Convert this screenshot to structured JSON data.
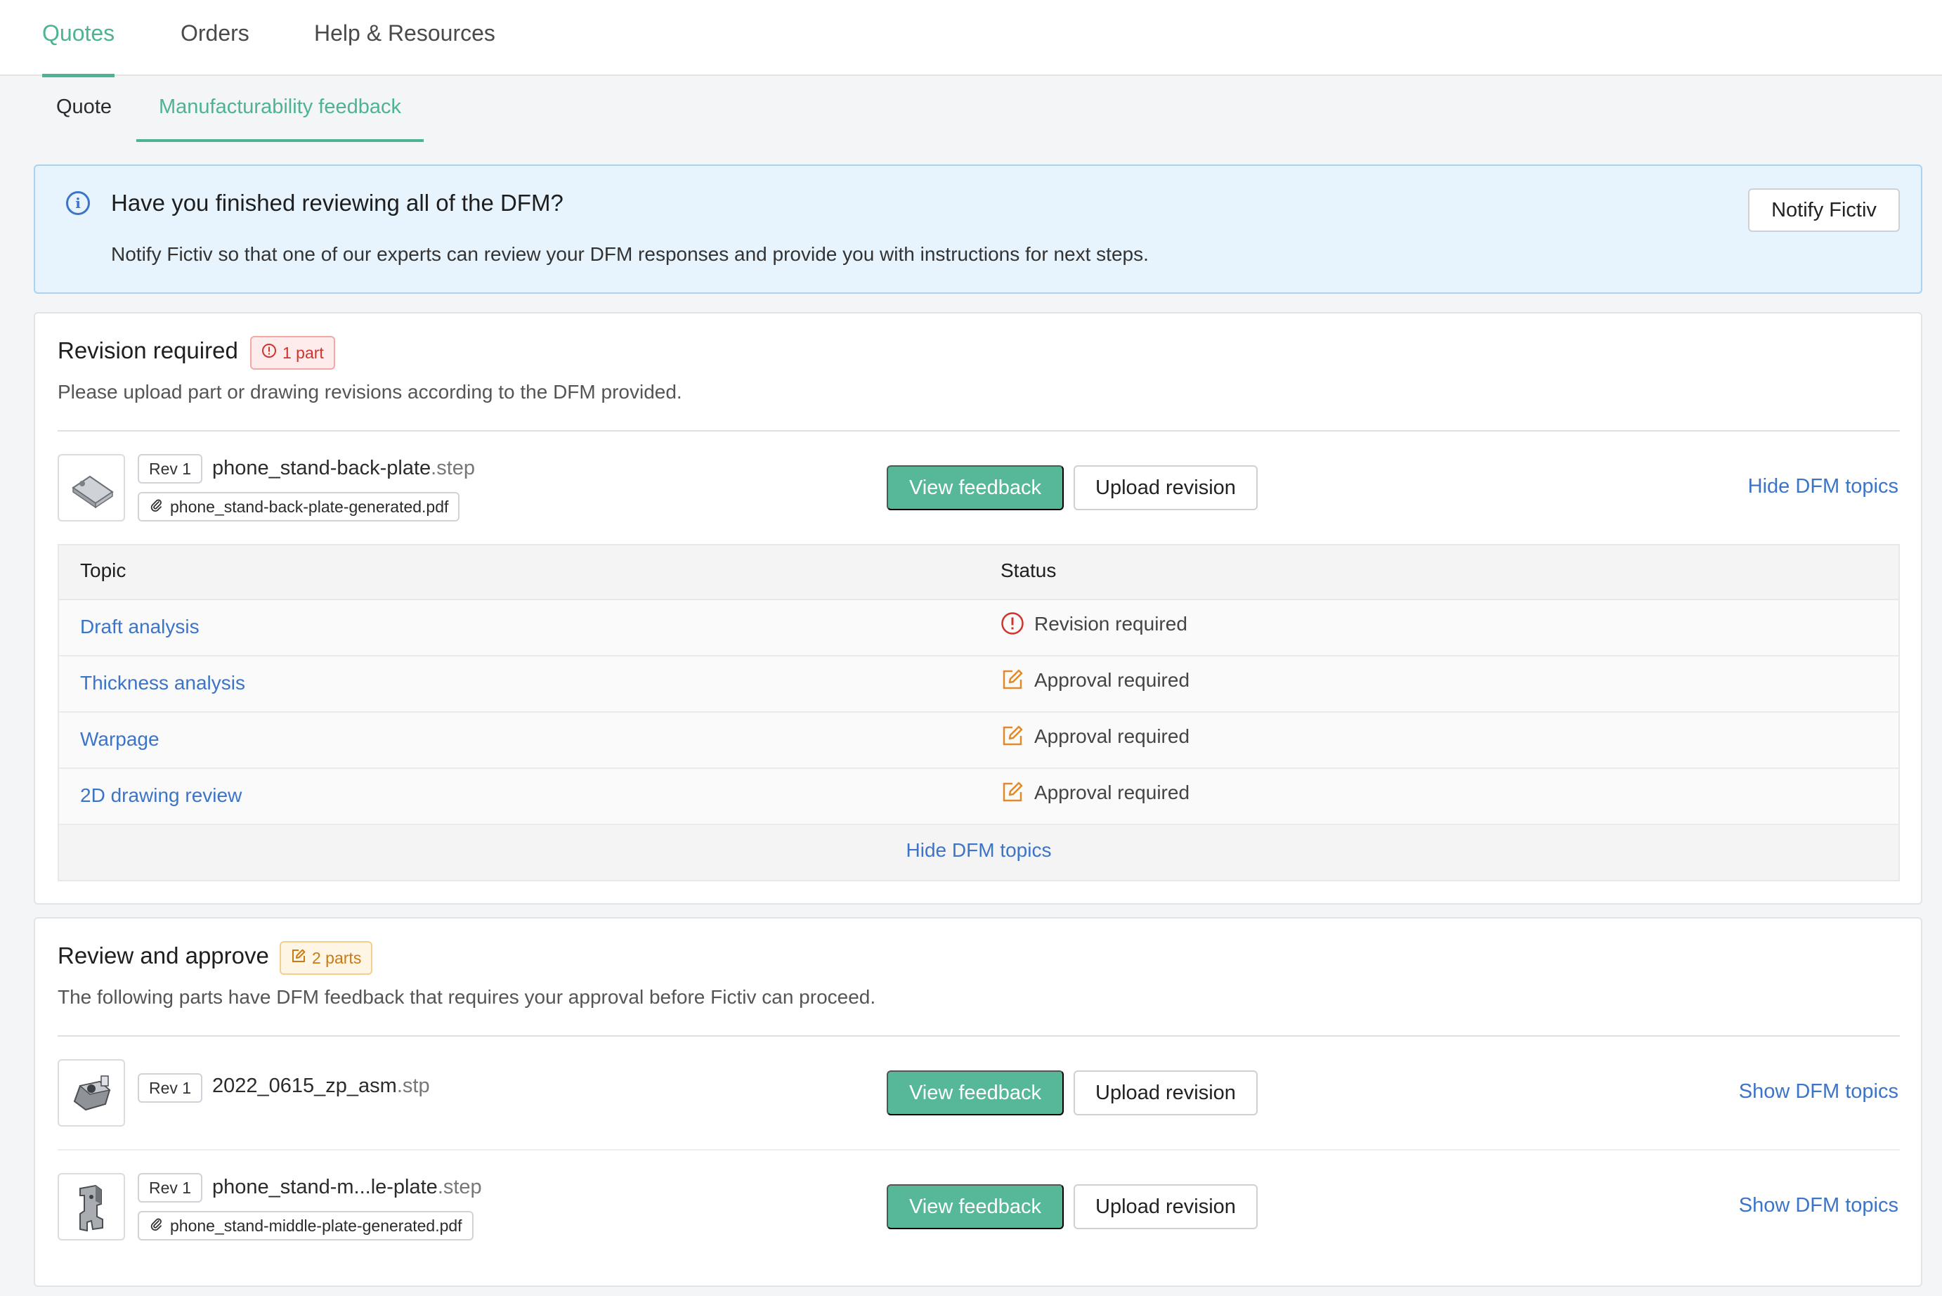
{
  "nav": {
    "tabs": [
      {
        "label": "Quotes",
        "active": true
      },
      {
        "label": "Orders",
        "active": false
      },
      {
        "label": "Help & Resources",
        "active": false
      }
    ]
  },
  "subnav": {
    "tabs": [
      {
        "label": "Quote",
        "active": false
      },
      {
        "label": "Manufacturability feedback",
        "active": true
      }
    ]
  },
  "banner": {
    "title": "Have you finished reviewing all of the DFM?",
    "description": "Notify Fictiv so that one of our experts can review your DFM responses and provide you with instructions for next steps.",
    "button": "Notify Fictiv",
    "icon": "info-icon"
  },
  "revision_section": {
    "heading": "Revision required",
    "badge": "1 part",
    "description": "Please upload part or drawing revisions according to the DFM provided.",
    "part": {
      "rev": "Rev 1",
      "name": "phone_stand-back-plate",
      "ext": ".step",
      "attachment": "phone_stand-back-plate-generated.pdf",
      "view_button": "View feedback",
      "upload_button": "Upload revision",
      "toggle_link": "Hide DFM topics"
    },
    "table": {
      "col_topic": "Topic",
      "col_status": "Status",
      "rows": [
        {
          "topic": "Draft analysis",
          "status": "Revision required",
          "status_type": "revision"
        },
        {
          "topic": "Thickness analysis",
          "status": "Approval required",
          "status_type": "approval"
        },
        {
          "topic": "Warpage",
          "status": "Approval required",
          "status_type": "approval"
        },
        {
          "topic": "2D drawing review",
          "status": "Approval required",
          "status_type": "approval"
        }
      ],
      "footer_link": "Hide DFM topics"
    }
  },
  "approve_section": {
    "heading": "Review and approve",
    "badge": "2 parts",
    "description": "The following parts have DFM feedback that requires your approval before Fictiv can proceed.",
    "parts": [
      {
        "rev": "Rev 1",
        "name": "2022_0615_zp_asm",
        "ext": ".stp",
        "view_button": "View feedback",
        "upload_button": "Upload revision",
        "toggle_link": "Show DFM topics"
      },
      {
        "rev": "Rev 1",
        "name": "phone_stand-m...le-plate",
        "ext": ".step",
        "attachment": "phone_stand-middle-plate-generated.pdf",
        "view_button": "View feedback",
        "upload_button": "Upload revision",
        "toggle_link": "Show DFM topics"
      }
    ]
  },
  "colors": {
    "accent_green": "#4db394",
    "link_blue": "#3c74c8",
    "revision_red": "#d0342c",
    "approval_orange": "#e08a2c",
    "banner_bg": "#e7f4fd"
  }
}
